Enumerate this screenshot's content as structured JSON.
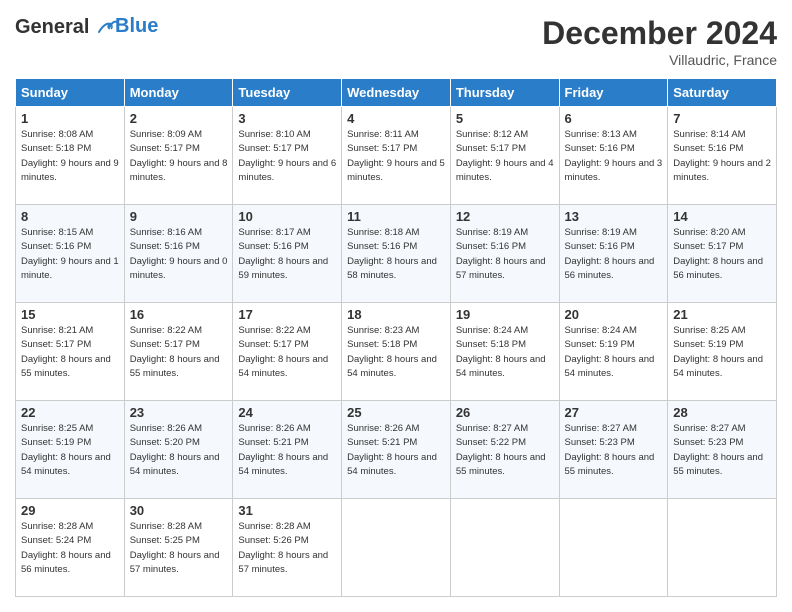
{
  "header": {
    "logo_line1": "General",
    "logo_line2": "Blue",
    "month_title": "December 2024",
    "location": "Villaudric, France"
  },
  "days_of_week": [
    "Sunday",
    "Monday",
    "Tuesday",
    "Wednesday",
    "Thursday",
    "Friday",
    "Saturday"
  ],
  "weeks": [
    [
      {
        "day": "1",
        "sunrise": "8:08 AM",
        "sunset": "5:18 PM",
        "daylight": "9 hours and 9 minutes."
      },
      {
        "day": "2",
        "sunrise": "8:09 AM",
        "sunset": "5:17 PM",
        "daylight": "9 hours and 8 minutes."
      },
      {
        "day": "3",
        "sunrise": "8:10 AM",
        "sunset": "5:17 PM",
        "daylight": "9 hours and 6 minutes."
      },
      {
        "day": "4",
        "sunrise": "8:11 AM",
        "sunset": "5:17 PM",
        "daylight": "9 hours and 5 minutes."
      },
      {
        "day": "5",
        "sunrise": "8:12 AM",
        "sunset": "5:17 PM",
        "daylight": "9 hours and 4 minutes."
      },
      {
        "day": "6",
        "sunrise": "8:13 AM",
        "sunset": "5:16 PM",
        "daylight": "9 hours and 3 minutes."
      },
      {
        "day": "7",
        "sunrise": "8:14 AM",
        "sunset": "5:16 PM",
        "daylight": "9 hours and 2 minutes."
      }
    ],
    [
      {
        "day": "8",
        "sunrise": "8:15 AM",
        "sunset": "5:16 PM",
        "daylight": "9 hours and 1 minute."
      },
      {
        "day": "9",
        "sunrise": "8:16 AM",
        "sunset": "5:16 PM",
        "daylight": "9 hours and 0 minutes."
      },
      {
        "day": "10",
        "sunrise": "8:17 AM",
        "sunset": "5:16 PM",
        "daylight": "8 hours and 59 minutes."
      },
      {
        "day": "11",
        "sunrise": "8:18 AM",
        "sunset": "5:16 PM",
        "daylight": "8 hours and 58 minutes."
      },
      {
        "day": "12",
        "sunrise": "8:19 AM",
        "sunset": "5:16 PM",
        "daylight": "8 hours and 57 minutes."
      },
      {
        "day": "13",
        "sunrise": "8:19 AM",
        "sunset": "5:16 PM",
        "daylight": "8 hours and 56 minutes."
      },
      {
        "day": "14",
        "sunrise": "8:20 AM",
        "sunset": "5:17 PM",
        "daylight": "8 hours and 56 minutes."
      }
    ],
    [
      {
        "day": "15",
        "sunrise": "8:21 AM",
        "sunset": "5:17 PM",
        "daylight": "8 hours and 55 minutes."
      },
      {
        "day": "16",
        "sunrise": "8:22 AM",
        "sunset": "5:17 PM",
        "daylight": "8 hours and 55 minutes."
      },
      {
        "day": "17",
        "sunrise": "8:22 AM",
        "sunset": "5:17 PM",
        "daylight": "8 hours and 54 minutes."
      },
      {
        "day": "18",
        "sunrise": "8:23 AM",
        "sunset": "5:18 PM",
        "daylight": "8 hours and 54 minutes."
      },
      {
        "day": "19",
        "sunrise": "8:24 AM",
        "sunset": "5:18 PM",
        "daylight": "8 hours and 54 minutes."
      },
      {
        "day": "20",
        "sunrise": "8:24 AM",
        "sunset": "5:19 PM",
        "daylight": "8 hours and 54 minutes."
      },
      {
        "day": "21",
        "sunrise": "8:25 AM",
        "sunset": "5:19 PM",
        "daylight": "8 hours and 54 minutes."
      }
    ],
    [
      {
        "day": "22",
        "sunrise": "8:25 AM",
        "sunset": "5:19 PM",
        "daylight": "8 hours and 54 minutes."
      },
      {
        "day": "23",
        "sunrise": "8:26 AM",
        "sunset": "5:20 PM",
        "daylight": "8 hours and 54 minutes."
      },
      {
        "day": "24",
        "sunrise": "8:26 AM",
        "sunset": "5:21 PM",
        "daylight": "8 hours and 54 minutes."
      },
      {
        "day": "25",
        "sunrise": "8:26 AM",
        "sunset": "5:21 PM",
        "daylight": "8 hours and 54 minutes."
      },
      {
        "day": "26",
        "sunrise": "8:27 AM",
        "sunset": "5:22 PM",
        "daylight": "8 hours and 55 minutes."
      },
      {
        "day": "27",
        "sunrise": "8:27 AM",
        "sunset": "5:23 PM",
        "daylight": "8 hours and 55 minutes."
      },
      {
        "day": "28",
        "sunrise": "8:27 AM",
        "sunset": "5:23 PM",
        "daylight": "8 hours and 55 minutes."
      }
    ],
    [
      {
        "day": "29",
        "sunrise": "8:28 AM",
        "sunset": "5:24 PM",
        "daylight": "8 hours and 56 minutes."
      },
      {
        "day": "30",
        "sunrise": "8:28 AM",
        "sunset": "5:25 PM",
        "daylight": "8 hours and 57 minutes."
      },
      {
        "day": "31",
        "sunrise": "8:28 AM",
        "sunset": "5:26 PM",
        "daylight": "8 hours and 57 minutes."
      },
      null,
      null,
      null,
      null
    ]
  ],
  "labels": {
    "sunrise": "Sunrise:",
    "sunset": "Sunset:",
    "daylight": "Daylight:"
  }
}
